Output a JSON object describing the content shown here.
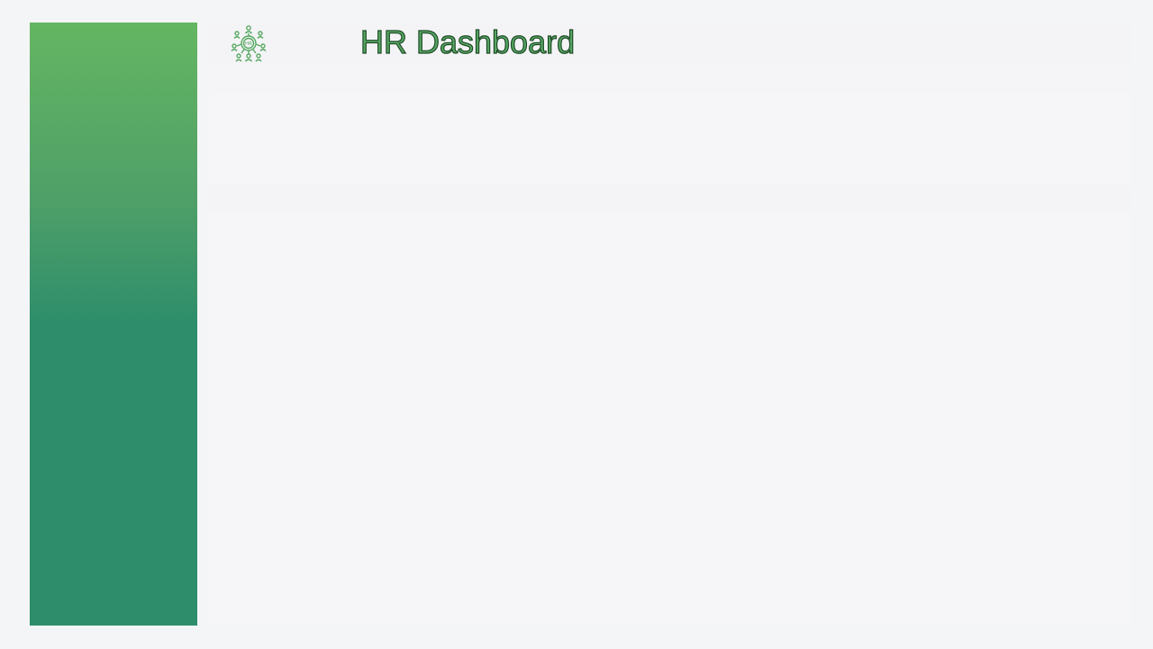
{
  "header": {
    "title": "HR Dashboard",
    "logo_icon": "hr-people-network-icon",
    "logo_text": "HR"
  },
  "colors": {
    "accent": "#57a862",
    "title_outline": "#1f4a28",
    "sidebar_top": "#65b662",
    "sidebar_bottom": "#2e8e6b",
    "background": "#f4f5f7"
  }
}
